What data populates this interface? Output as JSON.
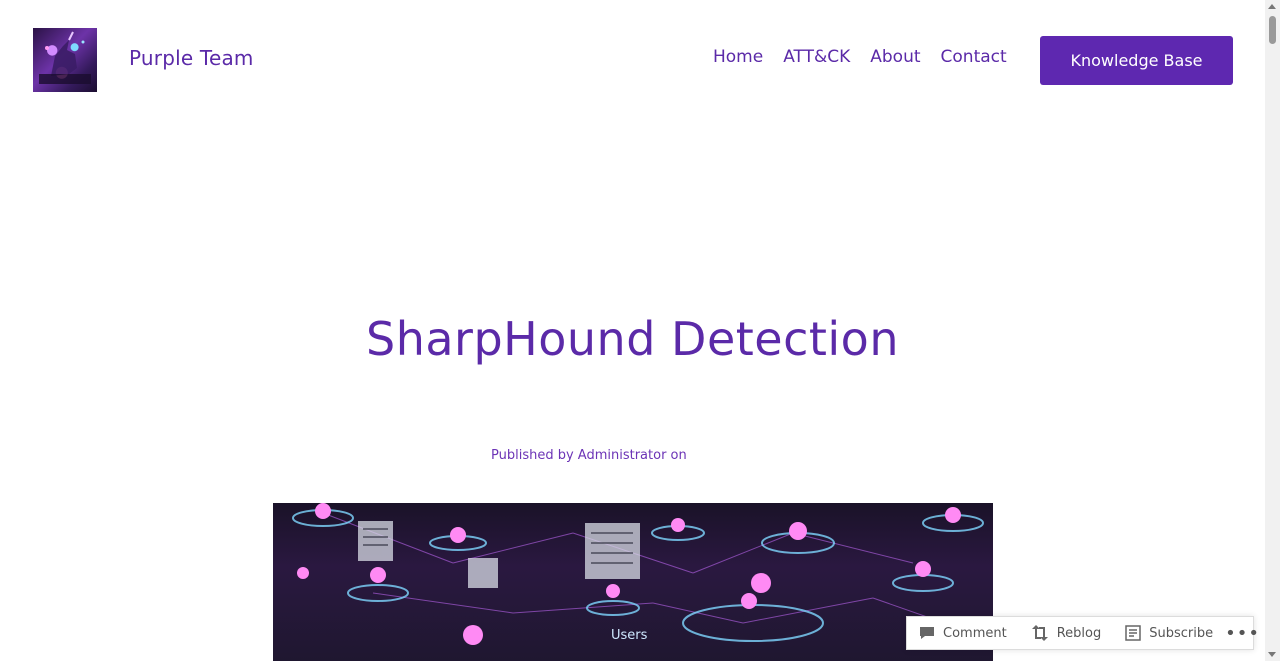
{
  "site": {
    "title": "Purple Team"
  },
  "nav": {
    "items": [
      {
        "label": "Home"
      },
      {
        "label": "ATT&CK"
      },
      {
        "label": "About"
      },
      {
        "label": "Contact"
      }
    ],
    "cta_label": "Knowledge Base"
  },
  "post": {
    "title": "SharpHound Detection",
    "meta": "Published by Administrator on",
    "featured_image_caption": "Users"
  },
  "actionbar": {
    "comment_label": "Comment",
    "reblog_label": "Reblog",
    "subscribe_label": "Subscribe",
    "more_label": "•••"
  },
  "colors": {
    "brand": "#5b2aa8",
    "button": "#5e28b0"
  }
}
